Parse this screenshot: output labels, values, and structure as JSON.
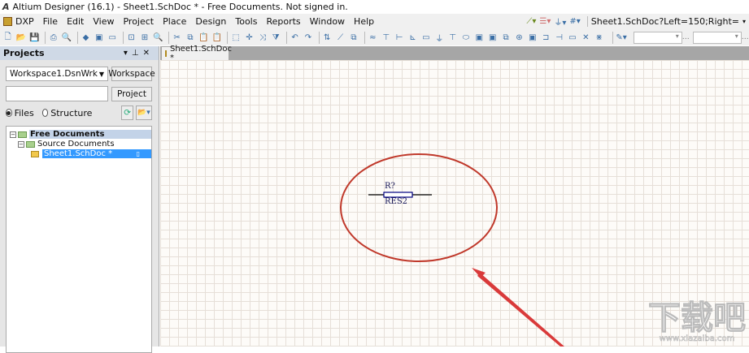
{
  "window": {
    "title": "Altium Designer (16.1) - Sheet1.SchDoc * - Free Documents. Not signed in.",
    "logo": "A"
  },
  "menu": [
    "DXP",
    "File",
    "Edit",
    "View",
    "Project",
    "Place",
    "Design",
    "Tools",
    "Reports",
    "Window",
    "Help"
  ],
  "address": "Sheet1.SchDoc?Left=150;Right=",
  "toolbar": {
    "icons": [
      "new",
      "open",
      "save",
      "print",
      "print-preview",
      "layers",
      "board",
      "doc",
      "zoom-fit",
      "zoom-area",
      "zoom-select",
      "cut",
      "copy",
      "paste",
      "paste-array",
      "select-rect",
      "move",
      "cross-select",
      "clear-filter",
      "undo",
      "redo",
      "up-down",
      "hierarchy",
      "browse",
      "wire",
      "bus",
      "bus-entry",
      "net-label",
      "net-label-text",
      "gnd",
      "vcc",
      "part",
      "sheet-symbol",
      "sheet-entry",
      "device-sheet",
      "harness",
      "port",
      "harness-connector",
      "harness-entry",
      "port-off",
      "no-erc",
      "generic-no-erc"
    ],
    "glyphs": [
      "🗋",
      "📂",
      "💾",
      "⎙",
      "🔍",
      "◆",
      "▣",
      "▭",
      "⊡",
      "⊞",
      "🔍",
      "✂",
      "⧉",
      "📋",
      "📋",
      "⬚",
      "✛",
      "⤨",
      "⧩",
      "↶",
      "↷",
      "⇅",
      "⟋",
      "⧉",
      "≈",
      "⊤",
      "⊢",
      "⊾",
      "▭",
      "⏚",
      "⊤",
      "⬭",
      "▣",
      "▣",
      "⧉",
      "⊛",
      "▣",
      "⊐",
      "⊣",
      "▭",
      "✕",
      "⋇"
    ]
  },
  "panel": {
    "title": "Projects",
    "workspace_value": "Workspace1.DsnWrk",
    "workspace_button": "Workspace",
    "project_value": "",
    "project_button": "Project",
    "radio_files": "Files",
    "radio_structure": "Structure",
    "tree": {
      "root": "Free Documents",
      "group": "Source Documents",
      "file": "Sheet1.SchDoc *"
    }
  },
  "tab": {
    "label": "Sheet1.SchDoc *"
  },
  "schematic": {
    "designator": "R?",
    "comment": "RES2"
  },
  "colors": {
    "annotation": "#c0392b",
    "selection": "#3399ff",
    "wire": "#000080"
  },
  "watermark": {
    "title": "下载吧",
    "url": "www.xiazaiba.com"
  }
}
